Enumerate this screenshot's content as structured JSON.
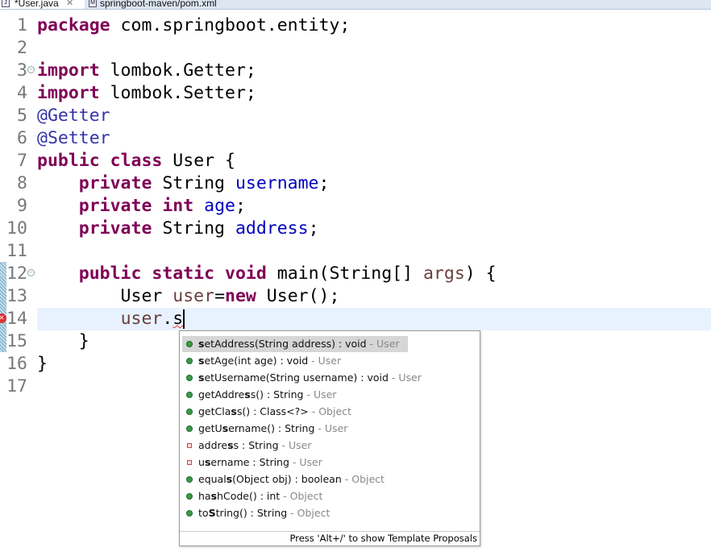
{
  "tabs": [
    {
      "label": "*User.java",
      "icon": "java-file-icon",
      "active": true
    },
    {
      "label": "springboot-maven/pom.xml",
      "icon": "maven-file-icon",
      "active": false
    }
  ],
  "editor": {
    "current_line": 14,
    "lines": [
      [
        [
          "package",
          "kw"
        ],
        [
          " com.springboot.entity;",
          ""
        ]
      ],
      [],
      [
        [
          "import",
          "kw"
        ],
        [
          " lombok.Getter;",
          ""
        ]
      ],
      [
        [
          "import",
          "kw"
        ],
        [
          " lombok.Setter;",
          ""
        ]
      ],
      [
        [
          "@Getter",
          "ann"
        ]
      ],
      [
        [
          "@Setter",
          "ann"
        ]
      ],
      [
        [
          "public",
          "kw"
        ],
        [
          " ",
          ""
        ],
        [
          "class",
          "kw"
        ],
        [
          " User {",
          ""
        ]
      ],
      [
        [
          "    ",
          ""
        ],
        [
          "private",
          "kw"
        ],
        [
          " String ",
          ""
        ],
        [
          "username",
          "fld"
        ],
        [
          ";",
          ""
        ]
      ],
      [
        [
          "    ",
          ""
        ],
        [
          "private",
          "kw"
        ],
        [
          " ",
          ""
        ],
        [
          "int",
          "kw"
        ],
        [
          " ",
          ""
        ],
        [
          "age",
          "fld"
        ],
        [
          ";",
          ""
        ]
      ],
      [
        [
          "    ",
          ""
        ],
        [
          "private",
          "kw"
        ],
        [
          " String ",
          ""
        ],
        [
          "address",
          "fld"
        ],
        [
          ";",
          ""
        ]
      ],
      [],
      [
        [
          "    ",
          ""
        ],
        [
          "public",
          "kw"
        ],
        [
          " ",
          ""
        ],
        [
          "static",
          "kw"
        ],
        [
          " ",
          ""
        ],
        [
          "void",
          "kw"
        ],
        [
          " main(String[] ",
          ""
        ],
        [
          "args",
          "loc"
        ],
        [
          ") {",
          ""
        ]
      ],
      [
        [
          "        User ",
          ""
        ],
        [
          "user",
          "loc"
        ],
        [
          "=",
          ""
        ],
        [
          "new",
          "kw"
        ],
        [
          " User();",
          ""
        ]
      ],
      [
        [
          "        ",
          ""
        ],
        [
          "user",
          "loc"
        ],
        [
          ".",
          ""
        ],
        [
          "s",
          "squig"
        ]
      ],
      [
        [
          "    }",
          ""
        ]
      ],
      [
        [
          "}",
          ""
        ]
      ],
      []
    ]
  },
  "proposals": {
    "items": [
      {
        "pre": "",
        "bold": "s",
        "post": "etAddress(String address) : void",
        "qual": " - User",
        "kind": "public-method",
        "selected": true
      },
      {
        "pre": "",
        "bold": "s",
        "post": "etAge(int age) : void",
        "qual": " - User",
        "kind": "public-method"
      },
      {
        "pre": "",
        "bold": "s",
        "post": "etUsername(String username) : void",
        "qual": " - User",
        "kind": "public-method"
      },
      {
        "pre": "getAddre",
        "bold": "s",
        "post": "s() : String",
        "qual": " - User",
        "kind": "public-method"
      },
      {
        "pre": "getCla",
        "bold": "s",
        "post": "s() : Class<?>",
        "qual": " - Object",
        "kind": "public-method"
      },
      {
        "pre": "getU",
        "bold": "s",
        "post": "ername() : String",
        "qual": " - User",
        "kind": "public-method"
      },
      {
        "pre": "addre",
        "bold": "s",
        "post": "s : String",
        "qual": " - User",
        "kind": "private-field"
      },
      {
        "pre": "u",
        "bold": "s",
        "post": "ername : String",
        "qual": " - User",
        "kind": "private-field"
      },
      {
        "pre": "equal",
        "bold": "s",
        "post": "(Object obj) : boolean",
        "qual": " - Object",
        "kind": "public-method"
      },
      {
        "pre": "ha",
        "bold": "s",
        "post": "hCode() : int",
        "qual": " - Object",
        "kind": "public-method"
      },
      {
        "pre": "to",
        "bold": "S",
        "post": "tring() : String",
        "qual": " - Object",
        "kind": "public-method"
      }
    ],
    "footer": "Press 'Alt+/' to show Template Proposals"
  }
}
